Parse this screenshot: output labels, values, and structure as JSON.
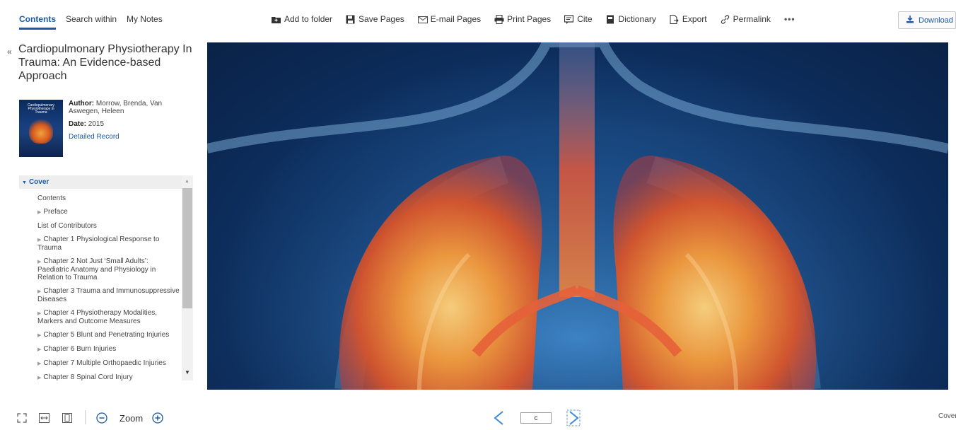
{
  "tabs": [
    {
      "label": "Contents",
      "active": true
    },
    {
      "label": "Search within",
      "active": false
    },
    {
      "label": "My Notes",
      "active": false
    }
  ],
  "toolbar": {
    "add_to_folder": "Add to folder",
    "save_pages": "Save Pages",
    "email_pages": "E-mail Pages",
    "print_pages": "Print Pages",
    "cite": "Cite",
    "dictionary": "Dictionary",
    "export": "Export",
    "permalink": "Permalink",
    "more": "•••",
    "download": "Download"
  },
  "sidebar": {
    "collapse": "«",
    "book_title": "Cardiopulmonary Physiotherapy In Trauma: An Evidence-based Approach",
    "cover_title": "Cardiopulmonary Physiotherapy in Trauma",
    "author_label": "Author:",
    "author": "Morrow, Brenda, Van Aswegen, Heleen",
    "date_label": "Date:",
    "date": "2015",
    "detailed_record": "Detailed Record"
  },
  "toc": {
    "current": "Cover",
    "items": [
      {
        "label": "Contents",
        "expandable": false
      },
      {
        "label": "Preface",
        "expandable": true
      },
      {
        "label": "List of Contributors",
        "expandable": false
      },
      {
        "label": "Chapter 1 Physiological Response to Trauma",
        "expandable": true
      },
      {
        "label": "Chapter 2 Not Just ‘Small Adults’: Paediatric Anatomy and Physiology in Relation to Trauma",
        "expandable": true
      },
      {
        "label": "Chapter 3 Trauma and Immunosuppressive Diseases",
        "expandable": true
      },
      {
        "label": "Chapter 4 Physiotherapy Modalities, Markers and Outcome Measures",
        "expandable": true
      },
      {
        "label": "Chapter 5 Blunt and Penetrating Injuries",
        "expandable": true
      },
      {
        "label": "Chapter 6 Burn Injuries",
        "expandable": true
      },
      {
        "label": "Chapter 7 Multiple Orthopaedic Injuries",
        "expandable": true
      },
      {
        "label": "Chapter 8 Spinal Cord Injury",
        "expandable": true
      }
    ]
  },
  "bottom": {
    "zoom_label": "Zoom",
    "page_value": "c",
    "page_label": "Cover"
  },
  "colors": {
    "accent": "#1a5aa6"
  }
}
